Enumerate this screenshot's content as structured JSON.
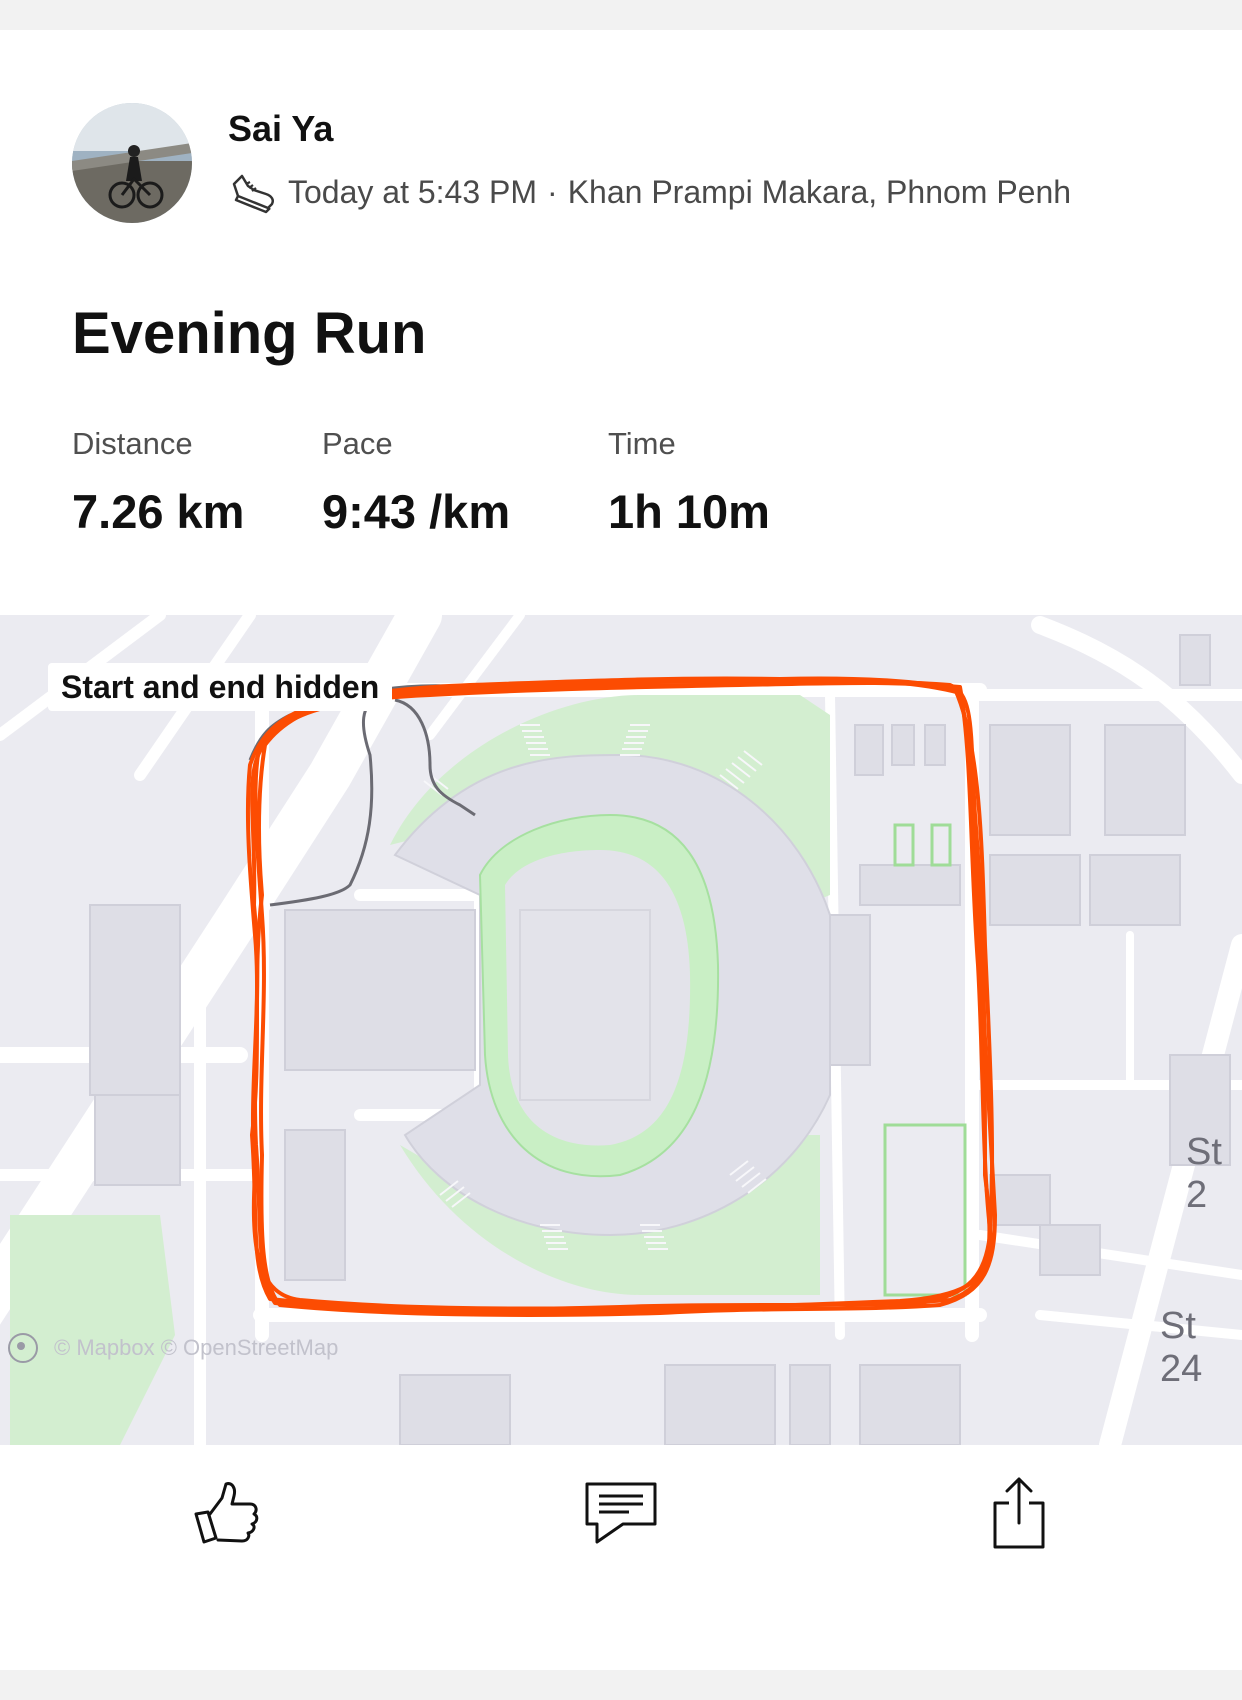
{
  "athlete": {
    "name": "Sai Ya",
    "timestamp": "Today at 5:43 PM",
    "separator": "·",
    "location": "Khan Prampi Makara, Phnom Penh",
    "activity_icon": "running-shoe-icon"
  },
  "activity": {
    "title": "Evening Run",
    "stats": [
      {
        "label": "Distance",
        "value": "7.26 km"
      },
      {
        "label": "Pace",
        "value": "9:43 /km"
      },
      {
        "label": "Time",
        "value": "1h 10m"
      }
    ]
  },
  "map": {
    "privacy_badge": "Start and end hidden",
    "attribution": "© Mapbox © OpenStreetMap",
    "street_labels": [
      "St 2",
      "St 24"
    ],
    "route_color": "#fc4c02",
    "hidden_route_color": "#6b6b73",
    "park_color": "#c9efc5"
  },
  "actions": {
    "kudos_icon": "thumbs-up-icon",
    "comment_icon": "comment-icon",
    "share_icon": "share-icon"
  }
}
